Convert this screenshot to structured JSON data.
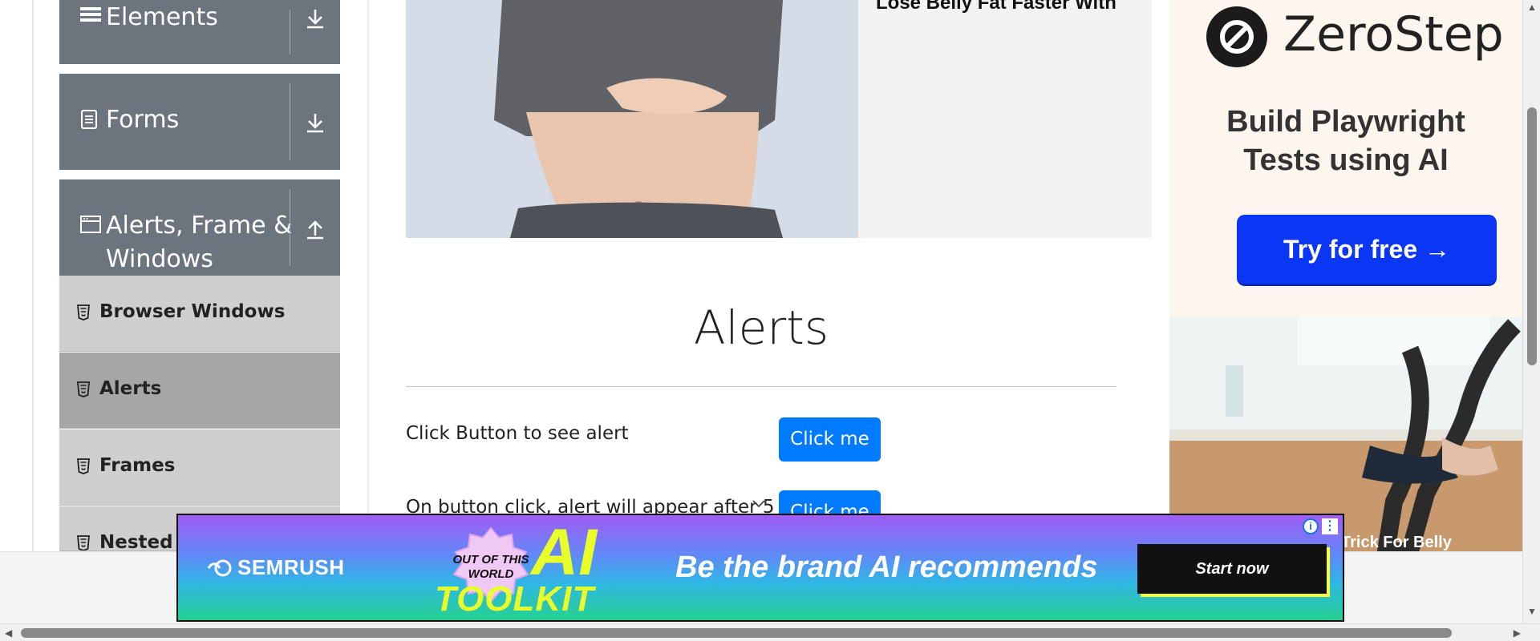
{
  "sidebar": {
    "groups": [
      {
        "label": "Elements",
        "icon": "menu-icon",
        "arrow": "download-arrow-icon"
      },
      {
        "label": "Forms",
        "icon": "document-icon",
        "arrow": "download-arrow-icon"
      },
      {
        "label_line1": "Alerts, Frame &",
        "label_line2": "Windows",
        "icon": "window-icon",
        "arrow": "upload-arrow-icon"
      }
    ],
    "items": [
      {
        "label": "Browser Windows",
        "active": false
      },
      {
        "label": "Alerts",
        "active": true
      },
      {
        "label": "Frames",
        "active": false
      },
      {
        "label": "Nested F",
        "active": false
      }
    ]
  },
  "hero": {
    "headline": "Lose Belly Fat Faster With"
  },
  "main": {
    "title": "Alerts",
    "rows": [
      {
        "text": "Click Button to see alert",
        "button": "Click me"
      },
      {
        "text": "On button click, alert will appear after 5",
        "button": "Click me"
      }
    ]
  },
  "right_ad": {
    "brand": "ZeroStep",
    "tagline_line1": "Build Playwright",
    "tagline_line2": "Tests using AI",
    "cta": "Try for free →",
    "caption": "Trick For Belly"
  },
  "banner": {
    "brand": "SEMRUSH",
    "badge_line1": "OUT OF THIS",
    "badge_line2": "WORLD",
    "ai": "AI",
    "toolkit": "TOOLKIT",
    "slogan": "Be the brand AI recommends",
    "cta": "Start now",
    "info_symbol": "i",
    "menu_symbol": "⋮"
  },
  "colors": {
    "sidebar_group": "#6c757d",
    "sidebar_item": "#cfcfcf",
    "sidebar_item_active": "#a6a6a6",
    "primary_button": "#007bff",
    "zerostep_cta": "#0b36f4",
    "banner_cta_shadow": "#f6ff3a"
  }
}
